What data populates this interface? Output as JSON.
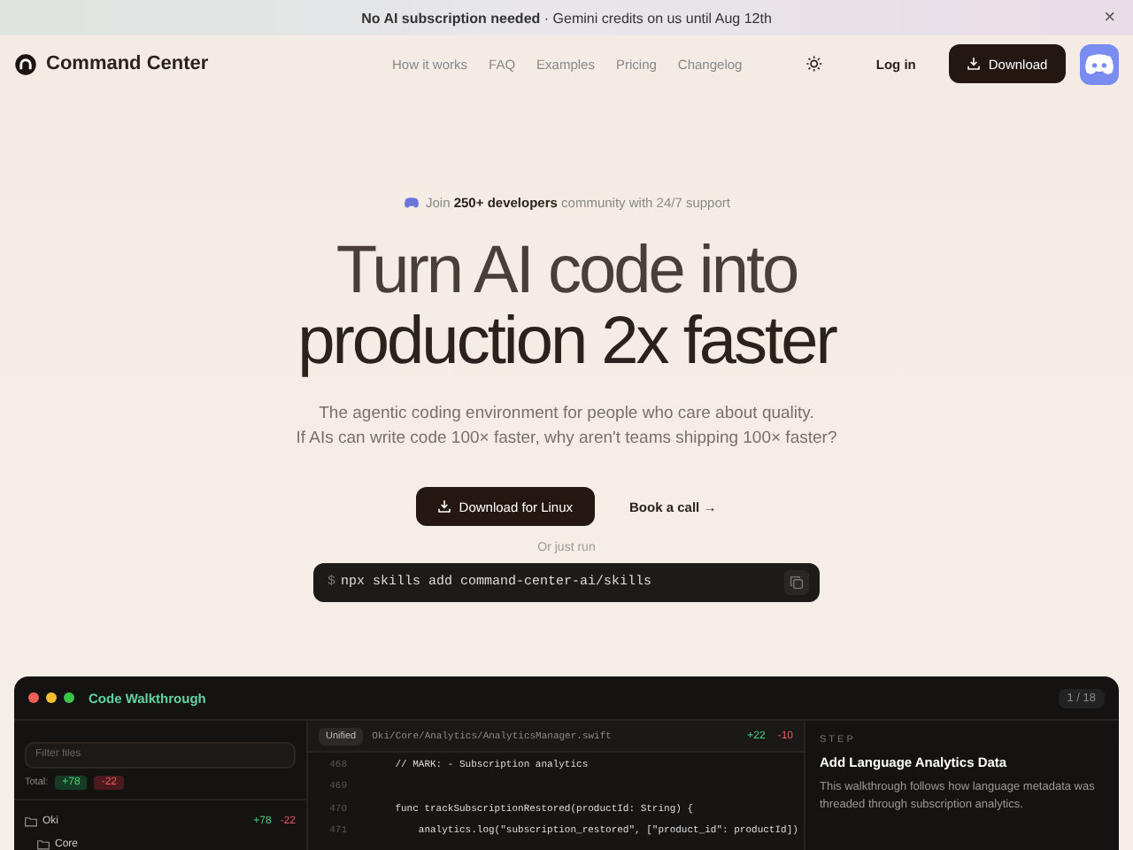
{
  "banner": {
    "text": "**No AI subscription needed** · Gemini credits on us until Aug 12th",
    "close": "×"
  },
  "nav": {
    "brand": "Command Center",
    "links": [
      "How it works",
      "FAQ",
      "Examples",
      "Pricing",
      "Changelog"
    ],
    "login": "Log in",
    "download": "Download"
  },
  "hero": {
    "community": "Join **250+ developers** community with 24/7 support",
    "title_lines": [
      "Turn AI code into",
      "production 2x faster"
    ],
    "subtitle_lines": [
      "The agentic coding environment for people who care about quality.",
      "If AIs can write code 100× faster, why aren't teams shipping 100× faster?"
    ],
    "primary": "Download for Linux",
    "secondary": "Book a call →",
    "or_run": "Or just run",
    "prompt": "$",
    "command": "npx skills add command-center-ai/skills"
  },
  "walkthrough": {
    "title": "Code Walkthrough",
    "counter": "1 / 18",
    "filter_placeholder": "Filter files",
    "total_label": "Total:",
    "total_added": "+78",
    "total_removed": "-22",
    "tree": [
      {
        "name": "Oki",
        "added": "+78",
        "removed": "-22",
        "children": [
          {
            "name": "Core"
          }
        ]
      }
    ],
    "view_mode": "Unified",
    "file_path": "Oki/Core/Analytics/AnalyticsManager.swift",
    "file_added": "+22",
    "file_removed": "-10",
    "lines": [
      {
        "number": "468",
        "code": "    // MARK: - Subscription analytics"
      },
      {
        "number": "469"
      },
      {
        "number": "470",
        "code": "    func trackSubscriptionRestored(productId: String) {"
      },
      {
        "number": "471",
        "code": "        analytics.log(\"subscription_restored\", [\"product_id\": productId])"
      }
    ],
    "step_label": "STEP",
    "step_title": "Add Language Analytics Data",
    "step_body": "This walkthrough follows how language metadata was threaded through subscription analytics."
  }
}
